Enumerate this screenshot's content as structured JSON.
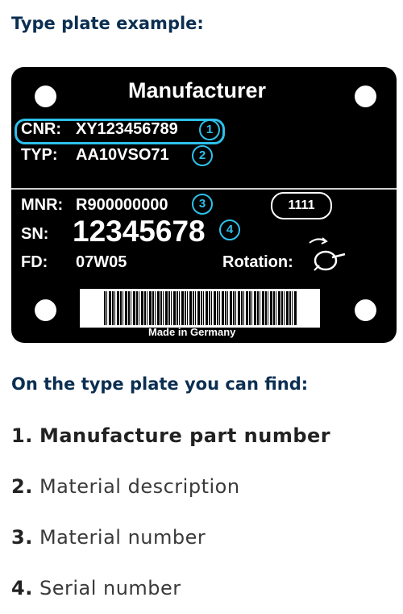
{
  "heading_top": "Type plate example:",
  "plate": {
    "manufacturer": "Manufacturer",
    "cnr_label": "CNR:",
    "cnr_value": "XY123456789",
    "typ_label": "TYP:",
    "typ_value": "AA10VSO71",
    "mnr_label": "MNR:",
    "mnr_value": "R900000000",
    "oval_value": "1111",
    "sn_label": "SN:",
    "sn_value": "12345678",
    "fd_label": "FD:",
    "fd_value": "07W05",
    "rotation_label": "Rotation:",
    "made_in": "Made in Germany",
    "badges": [
      "1",
      "2",
      "3",
      "4"
    ]
  },
  "heading_bottom": "On the type plate you can find:",
  "list": [
    {
      "num": "1.",
      "label": "Manufacture part number"
    },
    {
      "num": "2.",
      "label": "Material description"
    },
    {
      "num": "3.",
      "label": "Material number"
    },
    {
      "num": "4.",
      "label": "Serial number"
    }
  ],
  "colors": {
    "heading": "#0b2f52",
    "badge": "#2ec0ea",
    "plate": "#000000"
  },
  "icons": {
    "rotation": "rotation-arrow-icon"
  }
}
